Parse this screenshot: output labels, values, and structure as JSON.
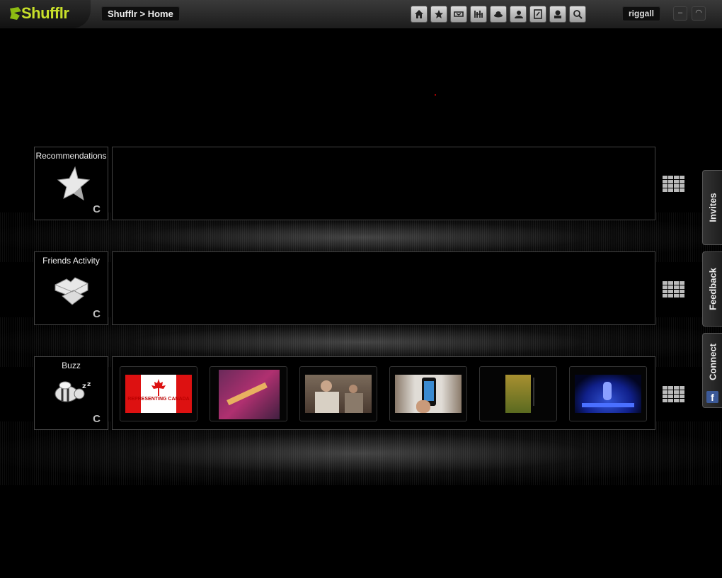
{
  "app": {
    "logo_text": "Shufflr"
  },
  "breadcrumb": "Shufflr > Home",
  "toolbar": {
    "buttons": [
      "home-icon",
      "star-icon",
      "playlist-icon",
      "equalizer-icon",
      "hat-icon",
      "person-icon",
      "note-icon",
      "alert-icon",
      "search-icon"
    ]
  },
  "user": {
    "name": "riggall"
  },
  "window": {
    "minimize": "–",
    "restore": "◠"
  },
  "rows": [
    {
      "title": "Recommendations",
      "icon": "star-icon",
      "refresh": "C"
    },
    {
      "title": "Friends Activity",
      "icon": "puzzle-icon",
      "refresh": "C"
    },
    {
      "title": "Buzz",
      "icon": "bee-icon",
      "refresh": "C"
    }
  ],
  "buzz_thumbs": [
    {
      "caption": "REPRESENTING CANADA",
      "kind": "canada-flag"
    },
    {
      "caption": "",
      "kind": "concert-red"
    },
    {
      "caption": "",
      "kind": "people-scene"
    },
    {
      "caption": "",
      "kind": "phone"
    },
    {
      "caption": "",
      "kind": "dark-poster"
    },
    {
      "caption": "",
      "kind": "stage-blue"
    }
  ],
  "side_tabs": [
    {
      "label": "Invites"
    },
    {
      "label": "Feedback"
    },
    {
      "label": "Connect",
      "icon": "facebook-icon",
      "icon_text": "f"
    }
  ],
  "colors": {
    "logo": "#c8e02a",
    "facebook": "#3b5998"
  }
}
